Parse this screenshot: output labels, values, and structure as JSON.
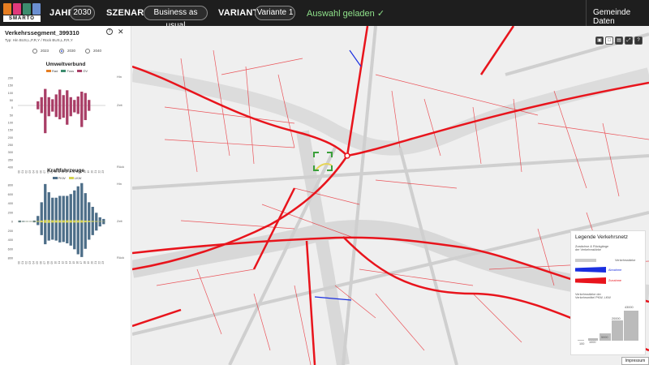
{
  "header": {
    "logo_text": "SMARTO",
    "year_label": "JAHR",
    "year_value": "2030",
    "scenario_label": "SZENARIO",
    "scenario_value": "Business as usual",
    "variant_label": "VARIANTE",
    "variant_value": "Variante 1",
    "status": "Auswahl geladen ✓",
    "municipality_button": "Gemeinde Daten"
  },
  "panel": {
    "title": "Verkehrssegment_399310",
    "subtitle": "Typ: Hin BUS,L,P,R,Y / Rück BUS,L,P,R,Y",
    "help_icon": "?",
    "close_icon": "✕",
    "years": [
      {
        "label": "2023",
        "selected": false
      },
      {
        "label": "2030",
        "selected": true
      },
      {
        "label": "2040",
        "selected": false
      }
    ]
  },
  "chart_data": [
    {
      "type": "bar",
      "title": "Umweltverbund",
      "series": [
        {
          "name": "Rad",
          "color": "#e67e22",
          "values": [
            0,
            0,
            0,
            0,
            0,
            0,
            0,
            0,
            0,
            0,
            0,
            0,
            0,
            0,
            0,
            0,
            0,
            0,
            0,
            0,
            0,
            0,
            0,
            0
          ]
        },
        {
          "name": "Fuss",
          "color": "#3d8c6e",
          "values": [
            0,
            0,
            0,
            0,
            0,
            0,
            0,
            0,
            0,
            0,
            0,
            0,
            0,
            0,
            0,
            0,
            0,
            0,
            0,
            0,
            0,
            0,
            0,
            0
          ]
        },
        {
          "name": "ÖV",
          "color": "#a93e66",
          "up": [
            0,
            0,
            0,
            0,
            0,
            30,
            60,
            120,
            60,
            45,
            80,
            115,
            75,
            110,
            60,
            40,
            65,
            100,
            90,
            40,
            0,
            0,
            0,
            0
          ],
          "down": [
            0,
            0,
            0,
            0,
            0,
            25,
            50,
            180,
            70,
            40,
            75,
            90,
            80,
            125,
            70,
            45,
            55,
            140,
            95,
            35,
            0,
            0,
            0,
            0
          ]
        }
      ],
      "categories": [
        "00",
        "01",
        "02",
        "03",
        "04",
        "05",
        "06",
        "07",
        "08",
        "09",
        "10",
        "11",
        "12",
        "13",
        "14",
        "15",
        "16",
        "17",
        "18",
        "19",
        "20",
        "21",
        "22",
        "23"
      ],
      "y_ticks": [
        "200",
        "150",
        "100",
        "50",
        "0",
        "50",
        "100",
        "150",
        "200",
        "250",
        "300",
        "350",
        "400"
      ],
      "side_labels": [
        "Hin",
        "Zeit",
        "Rück"
      ],
      "ylim": [
        -400,
        200
      ]
    },
    {
      "type": "bar",
      "title": "Kraftfahrzeuge",
      "series": [
        {
          "name": "PKW",
          "color": "#4d6e88",
          "up": [
            20,
            10,
            5,
            5,
            20,
            120,
            420,
            820,
            640,
            520,
            520,
            560,
            560,
            560,
            600,
            680,
            770,
            840,
            620,
            420,
            320,
            190,
            90,
            55
          ],
          "down": [
            20,
            10,
            5,
            5,
            20,
            80,
            300,
            500,
            420,
            400,
            420,
            460,
            450,
            480,
            530,
            610,
            720,
            780,
            600,
            400,
            300,
            200,
            110,
            60
          ]
        },
        {
          "name": "LKW",
          "color": "#d4d24e",
          "up": [
            3,
            2,
            2,
            2,
            4,
            10,
            20,
            30,
            30,
            25,
            25,
            25,
            25,
            25,
            25,
            25,
            25,
            25,
            20,
            15,
            10,
            8,
            5,
            3
          ],
          "down": [
            3,
            2,
            2,
            2,
            4,
            10,
            20,
            30,
            30,
            25,
            25,
            25,
            25,
            25,
            25,
            25,
            25,
            25,
            20,
            15,
            10,
            8,
            5,
            3
          ]
        }
      ],
      "categories": [
        "00",
        "01",
        "02",
        "03",
        "04",
        "05",
        "06",
        "07",
        "08",
        "09",
        "10",
        "11",
        "12",
        "13",
        "14",
        "15",
        "16",
        "17",
        "18",
        "19",
        "20",
        "21",
        "22",
        "23"
      ],
      "y_ticks": [
        "800",
        "600",
        "400",
        "200",
        "0",
        "200",
        "400",
        "600",
        "800"
      ],
      "side_labels": [
        "Hin",
        "Zeit",
        "Rück"
      ],
      "ylim": [
        -800,
        800
      ]
    }
  ],
  "map": {
    "tools": [
      "▣",
      "□",
      "▤",
      "⤢",
      "?"
    ],
    "legend": {
      "title": "Legende Verkehrsnetz",
      "change_caption": "Zuwächse & Rückgänge\nder Verkehrsstärke",
      "strength_label": "Verkehrsstärke",
      "decrease_label": "Abnahme",
      "increase_label": "Zunahme",
      "decrease_color": "#1a2fe0",
      "increase_color": "#e8141c",
      "volume_caption": "Verkehrsstärke der\nVerkehrsmittel PKW, LKW",
      "volume_values": [
        "100",
        "1000",
        "5000",
        "20000",
        "43000"
      ]
    },
    "impressum": "Impressum"
  }
}
